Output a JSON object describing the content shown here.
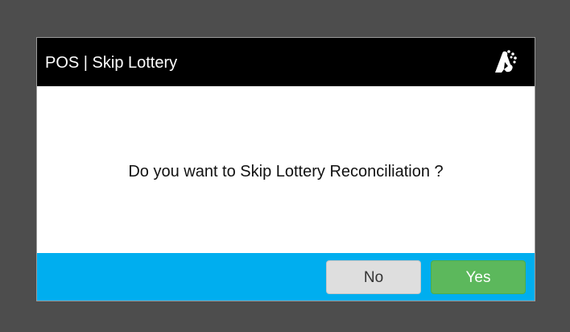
{
  "dialog": {
    "title": "POS | Skip Lottery",
    "logo_icon": "brand-logo-icon",
    "message": "Do you want to Skip Lottery Reconciliation ?",
    "buttons": {
      "no_label": "No",
      "yes_label": "Yes"
    }
  },
  "colors": {
    "backdrop": "#4d4d4d",
    "titlebar": "#000000",
    "footer": "#00aeef",
    "no_button": "#dedede",
    "yes_button": "#5cb85c"
  }
}
